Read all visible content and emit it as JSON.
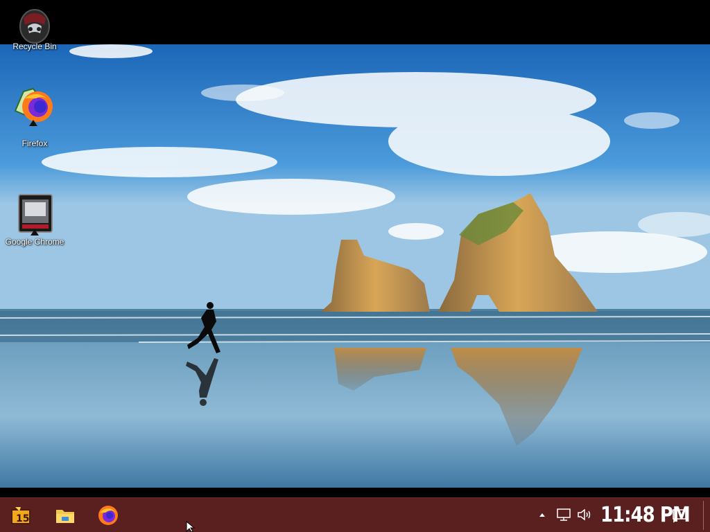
{
  "desktop": {
    "icons": [
      {
        "label": "Recycle Bin",
        "icon": "recycle-bin-icon"
      },
      {
        "label": "Firefox",
        "icon": "firefox-icon"
      },
      {
        "label": "Google Chrome",
        "icon": "chrome-icon"
      }
    ]
  },
  "taskbar": {
    "pinned": [
      {
        "icon": "start-icon"
      },
      {
        "icon": "file-explorer-icon"
      },
      {
        "icon": "firefox-icon"
      }
    ],
    "tray": {
      "chevron": "chevron-up-icon",
      "network": "network-icon",
      "volume": "volume-icon",
      "clock": "11:48 PM",
      "notifications": "notification-icon"
    },
    "color": "#5a1f1f"
  }
}
